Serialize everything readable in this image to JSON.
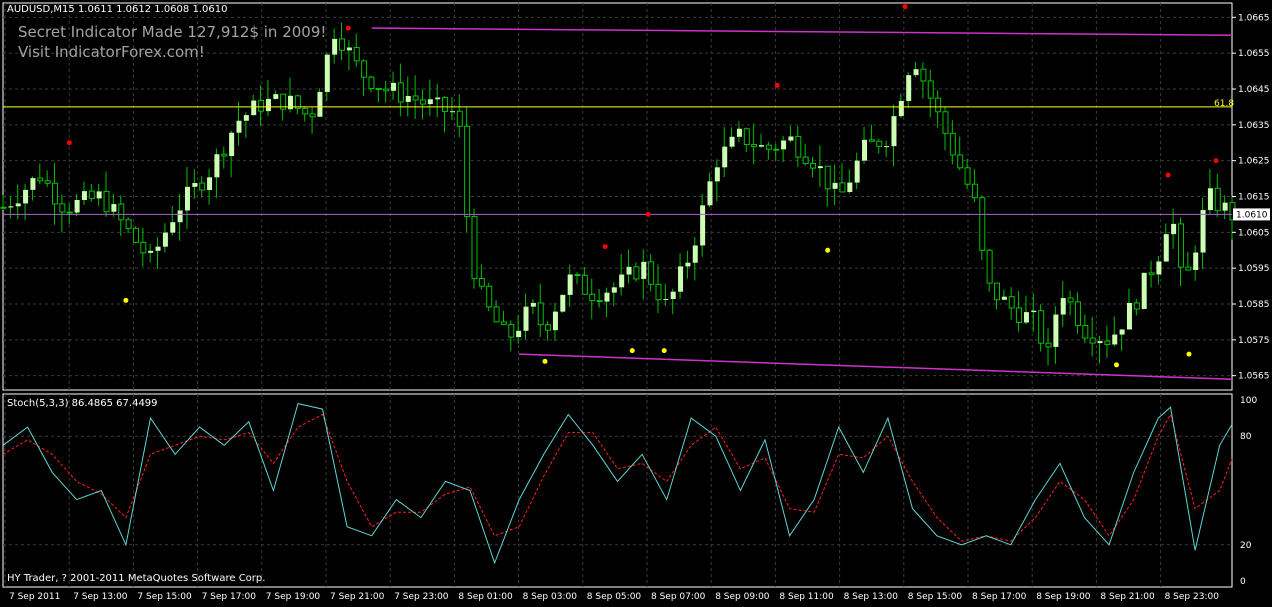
{
  "header": {
    "symbol_ohlc": "AUDUSD,M15  1.0611 1.0612 1.0608 1.0610",
    "ad_line1": "Secret Indicator Made 127,912$ in 2009!",
    "ad_line2": "Visit IndicatorForex.com!"
  },
  "subwindow": {
    "label": "Stoch(5,3,3) 86.4865 67.4499"
  },
  "footer": {
    "copyright": "HY Trader, ? 2001-2011 MetaQuotes Software Corp."
  },
  "fib_label": "61.8",
  "colors": {
    "background": "#000000",
    "grid": "#3a3a3a",
    "bull_candle": "#ccffb3",
    "wick": "#00c000",
    "fractal_up": "#ff0000",
    "fractal_down": "#ffff00",
    "channel": "#cc33cc",
    "fib_level": "#ffff00",
    "current_price_line": "#b060d0",
    "stoch_main": "#5fd6d6",
    "stoch_signal": "#ff2020",
    "axis_text": "#ffffff"
  },
  "chart_data": [
    {
      "type": "candlestick",
      "symbol": "AUDUSD",
      "timeframe": "M15",
      "y_ticks": [
        1.0665,
        1.0655,
        1.0645,
        1.0635,
        1.0625,
        1.0615,
        1.0605,
        1.0595,
        1.0585,
        1.0575,
        1.0565
      ],
      "ylim": [
        1.0561,
        1.0669
      ],
      "x_ticks": [
        "7 Sep 2011",
        "7 Sep 13:00",
        "7 Sep 15:00",
        "7 Sep 17:00",
        "7 Sep 19:00",
        "7 Sep 21:00",
        "7 Sep 23:00",
        "8 Sep 01:00",
        "8 Sep 03:00",
        "8 Sep 05:00",
        "8 Sep 07:00",
        "8 Sep 09:00",
        "8 Sep 11:00",
        "8 Sep 13:00",
        "8 Sep 15:00",
        "8 Sep 17:00",
        "8 Sep 19:00",
        "8 Sep 21:00",
        "8 Sep 23:00"
      ],
      "current_price": "1.0610",
      "fib_level": {
        "label": "61.8",
        "price": 1.064
      },
      "channel_upper": [
        [
          0.3,
          1.0662
        ],
        [
          1.0,
          1.066
        ]
      ],
      "channel_lower": [
        [
          0.42,
          1.0571
        ],
        [
          1.0,
          1.0564
        ]
      ],
      "grid": true,
      "close_path": [
        [
          0.0,
          1.0612
        ],
        [
          0.03,
          1.0621
        ],
        [
          0.05,
          1.0612
        ],
        [
          0.08,
          1.0615
        ],
        [
          0.1,
          1.0606
        ],
        [
          0.12,
          1.0597
        ],
        [
          0.14,
          1.0611
        ],
        [
          0.17,
          1.0623
        ],
        [
          0.19,
          1.0636
        ],
        [
          0.21,
          1.0641
        ],
        [
          0.23,
          1.0642
        ],
        [
          0.25,
          1.0637
        ],
        [
          0.27,
          1.0662
        ],
        [
          0.29,
          1.065
        ],
        [
          0.31,
          1.0645
        ],
        [
          0.33,
          1.0643
        ],
        [
          0.35,
          1.064
        ],
        [
          0.37,
          1.0638
        ],
        [
          0.38,
          1.0599
        ],
        [
          0.39,
          1.0586
        ],
        [
          0.41,
          1.0575
        ],
        [
          0.43,
          1.0584
        ],
        [
          0.44,
          1.0578
        ],
        [
          0.46,
          1.0592
        ],
        [
          0.48,
          1.0588
        ],
        [
          0.5,
          1.059
        ],
        [
          0.52,
          1.0596
        ],
        [
          0.54,
          1.0584
        ],
        [
          0.56,
          1.06
        ],
        [
          0.58,
          1.0625
        ],
        [
          0.6,
          1.0632
        ],
        [
          0.62,
          1.0628
        ],
        [
          0.64,
          1.0631
        ],
        [
          0.66,
          1.0625
        ],
        [
          0.68,
          1.0614
        ],
        [
          0.7,
          1.0628
        ],
        [
          0.72,
          1.0632
        ],
        [
          0.74,
          1.0655
        ],
        [
          0.76,
          1.0638
        ],
        [
          0.77,
          1.063
        ],
        [
          0.79,
          1.0614
        ],
        [
          0.8,
          1.059
        ],
        [
          0.82,
          1.0584
        ],
        [
          0.84,
          1.058
        ],
        [
          0.85,
          1.057
        ],
        [
          0.86,
          1.059
        ],
        [
          0.88,
          1.0578
        ],
        [
          0.9,
          1.0575
        ],
        [
          0.92,
          1.0585
        ],
        [
          0.94,
          1.0599
        ],
        [
          0.95,
          1.0612
        ],
        [
          0.96,
          1.0588
        ],
        [
          0.98,
          1.0615
        ],
        [
          1.0,
          1.061
        ]
      ],
      "fractals_up": [
        [
          0.054,
          1.063
        ],
        [
          0.281,
          1.0662
        ],
        [
          0.49,
          1.0601
        ],
        [
          0.525,
          1.061
        ],
        [
          0.63,
          1.0646
        ],
        [
          0.734,
          1.0668
        ],
        [
          0.948,
          1.0621
        ],
        [
          0.987,
          1.0625
        ]
      ],
      "fractals_down": [
        [
          0.1,
          1.0586
        ],
        [
          0.441,
          1.0569
        ],
        [
          0.512,
          1.0572
        ],
        [
          0.538,
          1.0572
        ],
        [
          0.671,
          1.06
        ],
        [
          0.906,
          1.0568
        ],
        [
          0.965,
          1.0571
        ]
      ]
    },
    {
      "type": "line",
      "indicator": "Stochastic",
      "params": "(5,3,3)",
      "main_value": 86.4865,
      "signal_value": 67.4499,
      "y_ticks": [
        100,
        80,
        20,
        0
      ],
      "ylim": [
        0,
        100
      ],
      "main_path": [
        [
          0.0,
          75
        ],
        [
          0.02,
          85
        ],
        [
          0.04,
          60
        ],
        [
          0.06,
          45
        ],
        [
          0.08,
          50
        ],
        [
          0.1,
          20
        ],
        [
          0.12,
          90
        ],
        [
          0.14,
          70
        ],
        [
          0.16,
          85
        ],
        [
          0.18,
          75
        ],
        [
          0.2,
          88
        ],
        [
          0.22,
          50
        ],
        [
          0.24,
          98
        ],
        [
          0.26,
          95
        ],
        [
          0.28,
          30
        ],
        [
          0.3,
          25
        ],
        [
          0.32,
          45
        ],
        [
          0.34,
          35
        ],
        [
          0.36,
          55
        ],
        [
          0.38,
          50
        ],
        [
          0.4,
          10
        ],
        [
          0.42,
          45
        ],
        [
          0.44,
          70
        ],
        [
          0.46,
          92
        ],
        [
          0.48,
          75
        ],
        [
          0.5,
          55
        ],
        [
          0.52,
          70
        ],
        [
          0.54,
          45
        ],
        [
          0.56,
          90
        ],
        [
          0.58,
          80
        ],
        [
          0.6,
          50
        ],
        [
          0.62,
          78
        ],
        [
          0.64,
          25
        ],
        [
          0.66,
          45
        ],
        [
          0.68,
          85
        ],
        [
          0.7,
          60
        ],
        [
          0.72,
          90
        ],
        [
          0.74,
          40
        ],
        [
          0.76,
          25
        ],
        [
          0.78,
          20
        ],
        [
          0.8,
          25
        ],
        [
          0.82,
          20
        ],
        [
          0.84,
          45
        ],
        [
          0.86,
          65
        ],
        [
          0.88,
          35
        ],
        [
          0.9,
          20
        ],
        [
          0.92,
          60
        ],
        [
          0.94,
          90
        ],
        [
          0.95,
          96
        ],
        [
          0.97,
          17
        ],
        [
          0.99,
          75
        ],
        [
          1.0,
          86.5
        ]
      ],
      "signal_path": [
        [
          0.0,
          70
        ],
        [
          0.02,
          78
        ],
        [
          0.04,
          70
        ],
        [
          0.06,
          55
        ],
        [
          0.08,
          48
        ],
        [
          0.1,
          35
        ],
        [
          0.12,
          70
        ],
        [
          0.14,
          75
        ],
        [
          0.16,
          80
        ],
        [
          0.18,
          78
        ],
        [
          0.2,
          82
        ],
        [
          0.22,
          65
        ],
        [
          0.24,
          85
        ],
        [
          0.26,
          92
        ],
        [
          0.28,
          55
        ],
        [
          0.3,
          30
        ],
        [
          0.32,
          38
        ],
        [
          0.34,
          38
        ],
        [
          0.36,
          48
        ],
        [
          0.38,
          52
        ],
        [
          0.4,
          25
        ],
        [
          0.42,
          30
        ],
        [
          0.44,
          58
        ],
        [
          0.46,
          82
        ],
        [
          0.48,
          82
        ],
        [
          0.5,
          62
        ],
        [
          0.52,
          65
        ],
        [
          0.54,
          55
        ],
        [
          0.56,
          75
        ],
        [
          0.58,
          85
        ],
        [
          0.6,
          62
        ],
        [
          0.62,
          68
        ],
        [
          0.64,
          40
        ],
        [
          0.66,
          38
        ],
        [
          0.68,
          70
        ],
        [
          0.7,
          68
        ],
        [
          0.72,
          80
        ],
        [
          0.74,
          55
        ],
        [
          0.76,
          35
        ],
        [
          0.78,
          22
        ],
        [
          0.8,
          25
        ],
        [
          0.82,
          22
        ],
        [
          0.84,
          35
        ],
        [
          0.86,
          55
        ],
        [
          0.88,
          45
        ],
        [
          0.9,
          25
        ],
        [
          0.92,
          45
        ],
        [
          0.94,
          80
        ],
        [
          0.95,
          92
        ],
        [
          0.97,
          40
        ],
        [
          0.99,
          50
        ],
        [
          1.0,
          67.4
        ]
      ],
      "grid": true
    }
  ]
}
